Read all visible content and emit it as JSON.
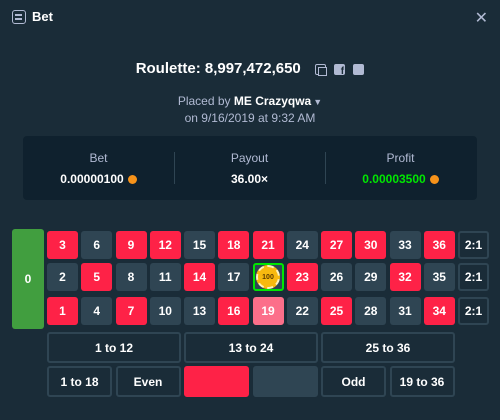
{
  "titlebar": {
    "title": "Bet"
  },
  "game": {
    "label": "Roulette: 8,997,472,650"
  },
  "placed": {
    "prefix": "Placed by",
    "user": "ME Crazyqwa",
    "date": "on 9/16/2019 at 9:32 AM"
  },
  "stats": [
    {
      "label": "Bet",
      "value": "0.00000100",
      "color": "#ffffff"
    },
    {
      "label": "Payout",
      "value": "36.00×",
      "color": "#ffffff"
    },
    {
      "label": "Profit",
      "value": "0.00003500",
      "color": "#00e701"
    }
  ],
  "board": {
    "zero": "0",
    "row_top": [
      "3",
      "6",
      "9",
      "12",
      "15",
      "18",
      "21",
      "24",
      "27",
      "30",
      "33",
      "36"
    ],
    "row_mid": [
      "2",
      "5",
      "8",
      "11",
      "14",
      "17",
      "20",
      "23",
      "26",
      "29",
      "32",
      "35"
    ],
    "row_bot": [
      "1",
      "4",
      "7",
      "10",
      "13",
      "16",
      "19",
      "22",
      "25",
      "28",
      "31",
      "34"
    ],
    "red_numbers": [
      "1",
      "3",
      "5",
      "7",
      "9",
      "12",
      "14",
      "16",
      "18",
      "19",
      "21",
      "23",
      "25",
      "27",
      "30",
      "32",
      "34",
      "36"
    ],
    "column_bets": [
      "2:1",
      "2:1",
      "2:1"
    ],
    "dozens": [
      "1 to 12",
      "13 to 24",
      "25 to 36"
    ],
    "outside": [
      "1 to 18",
      "Even",
      "",
      "",
      "Odd",
      "19 to 36"
    ],
    "winning_number": "19",
    "chip_number": "20",
    "chip_label": "100"
  },
  "colors": {
    "red": "#fe2247",
    "black": "#2f4553",
    "green": "#419e3f",
    "win": "#00e701",
    "chip": "#f7b90f"
  }
}
